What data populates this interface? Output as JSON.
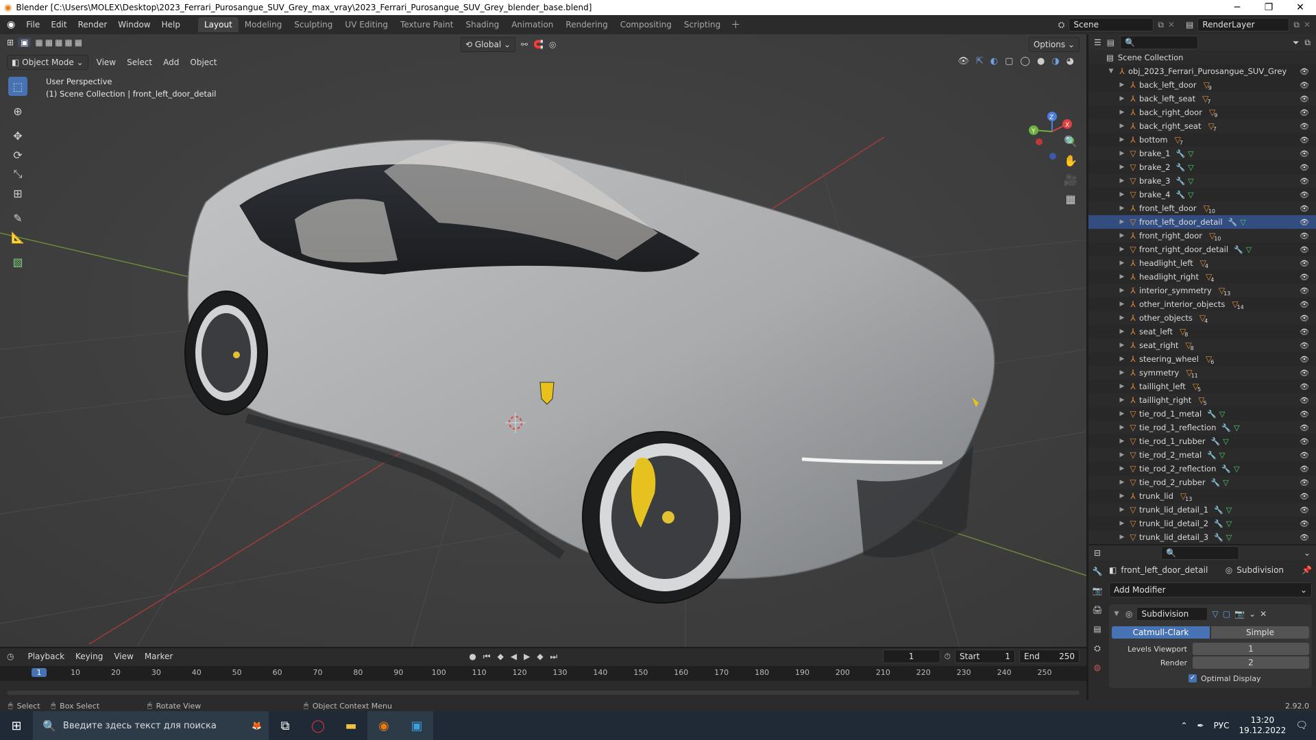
{
  "window": {
    "title": "Blender [C:\\Users\\MOLEX\\Desktop\\2023_Ferrari_Purosangue_SUV_Grey_max_vray\\2023_Ferrari_Purosangue_SUV_Grey_blender_base.blend]"
  },
  "menu": [
    "File",
    "Edit",
    "Render",
    "Window",
    "Help"
  ],
  "workspaces": [
    "Layout",
    "Modeling",
    "Sculpting",
    "UV Editing",
    "Texture Paint",
    "Shading",
    "Animation",
    "Rendering",
    "Compositing",
    "Scripting"
  ],
  "scene_name": "Scene",
  "render_layer": "RenderLayer",
  "viewport": {
    "mode": "Object Mode",
    "menus": [
      "View",
      "Select",
      "Add",
      "Object"
    ],
    "orientation": "Global",
    "options": "Options",
    "overlay_line1": "User Perspective",
    "overlay_line2": "(1) Scene Collection | front_left_door_detail",
    "axes": {
      "x": "X",
      "y": "Y",
      "z": "Z"
    }
  },
  "outliner": {
    "root": "Scene Collection",
    "collection": "obj_2023_Ferrari_Purosangue_SUV_Grey",
    "items": [
      {
        "name": "back_left_door",
        "badge": "9",
        "kind": "empty"
      },
      {
        "name": "back_left_seat",
        "badge": "7",
        "kind": "empty"
      },
      {
        "name": "back_right_door",
        "badge": "9",
        "kind": "empty"
      },
      {
        "name": "back_right_seat",
        "badge": "7",
        "kind": "empty"
      },
      {
        "name": "bottom",
        "badge": "7",
        "kind": "empty"
      },
      {
        "name": "brake_1",
        "badge": "",
        "kind": "mesh"
      },
      {
        "name": "brake_2",
        "badge": "",
        "kind": "mesh"
      },
      {
        "name": "brake_3",
        "badge": "",
        "kind": "mesh"
      },
      {
        "name": "brake_4",
        "badge": "",
        "kind": "mesh"
      },
      {
        "name": "front_left_door",
        "badge": "10",
        "kind": "empty"
      },
      {
        "name": "front_left_door_detail",
        "badge": "",
        "kind": "mesh",
        "selected": true
      },
      {
        "name": "front_right_door",
        "badge": "10",
        "kind": "empty"
      },
      {
        "name": "front_right_door_detail",
        "badge": "",
        "kind": "mesh"
      },
      {
        "name": "headlight_left",
        "badge": "4",
        "kind": "empty"
      },
      {
        "name": "headlight_right",
        "badge": "4",
        "kind": "empty"
      },
      {
        "name": "interior_symmetry",
        "badge": "13",
        "kind": "empty"
      },
      {
        "name": "other_interior_objects",
        "badge": "14",
        "kind": "empty"
      },
      {
        "name": "other_objects",
        "badge": "4",
        "kind": "empty"
      },
      {
        "name": "seat_left",
        "badge": "8",
        "kind": "empty"
      },
      {
        "name": "seat_right",
        "badge": "8",
        "kind": "empty"
      },
      {
        "name": "steering_wheel",
        "badge": "6",
        "kind": "empty"
      },
      {
        "name": "symmetry",
        "badge": "11",
        "kind": "empty"
      },
      {
        "name": "taillight_left",
        "badge": "5",
        "kind": "empty"
      },
      {
        "name": "taillight_right",
        "badge": "5",
        "kind": "empty"
      },
      {
        "name": "tie_rod_1_metal",
        "badge": "",
        "kind": "mesh"
      },
      {
        "name": "tie_rod_1_reflection",
        "badge": "",
        "kind": "mesh"
      },
      {
        "name": "tie_rod_1_rubber",
        "badge": "",
        "kind": "mesh"
      },
      {
        "name": "tie_rod_2_metal",
        "badge": "",
        "kind": "mesh"
      },
      {
        "name": "tie_rod_2_reflection",
        "badge": "",
        "kind": "mesh"
      },
      {
        "name": "tie_rod_2_rubber",
        "badge": "",
        "kind": "mesh"
      },
      {
        "name": "trunk_lid",
        "badge": "13",
        "kind": "empty"
      },
      {
        "name": "trunk_lid_detail_1",
        "badge": "",
        "kind": "mesh"
      },
      {
        "name": "trunk_lid_detail_2",
        "badge": "",
        "kind": "mesh"
      },
      {
        "name": "trunk_lid_detail_3",
        "badge": "",
        "kind": "mesh"
      }
    ]
  },
  "properties": {
    "object": "front_left_door_detail",
    "modifier_tab": "Subdivision",
    "add_modifier": "Add Modifier",
    "modifier_name": "Subdivision",
    "mode_a": "Catmull-Clark",
    "mode_b": "Simple",
    "levels_viewport_label": "Levels Viewport",
    "levels_viewport": "1",
    "render_label": "Render",
    "render_value": "2",
    "optimal_display": "Optimal Display"
  },
  "timeline": {
    "menus": [
      "Playback",
      "Keying",
      "View",
      "Marker"
    ],
    "current_frame": "1",
    "start_label": "Start",
    "start": "1",
    "end_label": "End",
    "end": "250",
    "ticks": [
      "1",
      "10",
      "20",
      "30",
      "40",
      "50",
      "60",
      "70",
      "80",
      "90",
      "100",
      "110",
      "120",
      "130",
      "140",
      "150",
      "160",
      "170",
      "180",
      "190",
      "200",
      "210",
      "220",
      "230",
      "240",
      "250"
    ]
  },
  "status": {
    "select": "Select",
    "box_select": "Box Select",
    "rotate": "Rotate View",
    "context": "Object Context Menu",
    "version": "2.92.0"
  },
  "taskbar": {
    "search_placeholder": "Введите здесь текст для поиска",
    "lang": "РУС",
    "time": "13:20",
    "date": "19.12.2022"
  }
}
